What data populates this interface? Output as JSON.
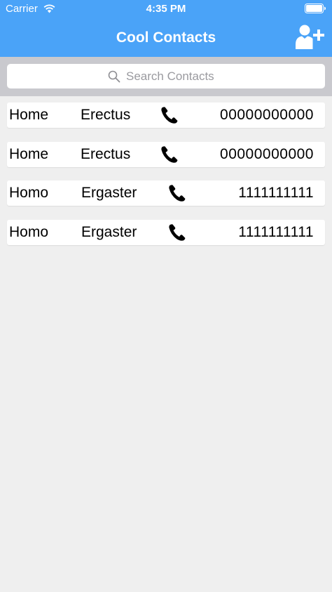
{
  "status_bar": {
    "carrier": "Carrier",
    "time": "4:35 PM",
    "wifi_icon": "wifi-icon",
    "battery_icon": "battery-icon"
  },
  "nav": {
    "title": "Cool Contacts",
    "add_icon": "add-contact-icon"
  },
  "search": {
    "placeholder": "Search Contacts",
    "value": "",
    "icon": "search-icon"
  },
  "contacts": [
    {
      "first": "Home",
      "last": "Erectus",
      "phone": "00000000000"
    },
    {
      "first": "Home",
      "last": "Erectus",
      "phone": "00000000000"
    },
    {
      "first": "Homo",
      "last": "Ergaster",
      "phone": "1111111111"
    },
    {
      "first": "Homo",
      "last": "Ergaster",
      "phone": "1111111111"
    }
  ],
  "colors": {
    "header": "#4aa3f8",
    "search_bar": "#c9c9ce",
    "background": "#efefef",
    "row": "#ffffff"
  }
}
